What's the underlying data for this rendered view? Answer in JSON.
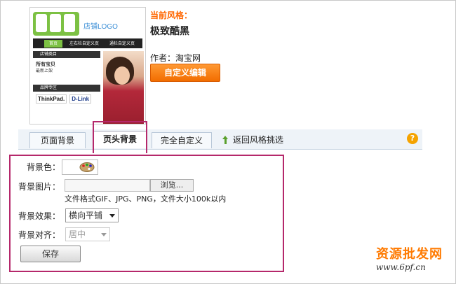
{
  "thumbnail": {
    "logo_text": "店铺LOGO",
    "nav": [
      "首页",
      "左右栏自定义页",
      "通栏自定义页"
    ],
    "side_category_title": "店铺类目",
    "side_links": [
      "所有宝贝",
      "最新上架"
    ],
    "side_brand_title": "品牌专区",
    "brands": [
      "ThinkPad.",
      "D-Link"
    ]
  },
  "info": {
    "current_style_label": "当前风格：",
    "style_name": "极致酷黑",
    "author": "作者：淘宝网",
    "customize_button": "自定义编辑"
  },
  "tabs": [
    {
      "label": "页面背景",
      "active": false
    },
    {
      "label": "页头背景",
      "active": true
    },
    {
      "label": "完全自定义",
      "active": false
    }
  ],
  "back_link": "返回风格挑选",
  "help_icon": "?",
  "form": {
    "bg_color_label": "背景色：",
    "bg_image_label": "背景图片：",
    "browse_button": "浏览...",
    "file_hint": "文件格式GIF、JPG、PNG，文件大小100k以内",
    "bg_effect_label": "背景效果：",
    "bg_effect_value": "横向平铺",
    "bg_align_label": "背景对齐：",
    "bg_align_value": "居中",
    "save_button": "保存"
  },
  "watermark": {
    "text": "资源批发网",
    "url": "www.6pf.cn"
  },
  "colors": {
    "accent_orange": "#ff6600",
    "highlight": "#b5286b",
    "tabbar_bg": "#eef3f8"
  }
}
